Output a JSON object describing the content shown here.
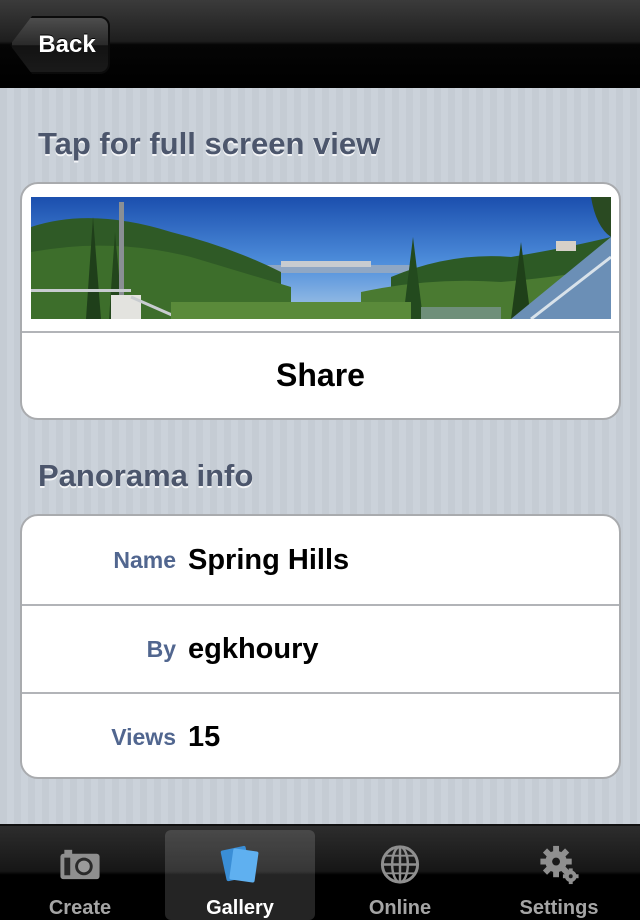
{
  "navbar": {
    "back_label": "Back"
  },
  "sections": {
    "image_header": "Tap for full screen view",
    "info_header": "Panorama info"
  },
  "image_group": {
    "share_label": "Share"
  },
  "info": {
    "rows": [
      {
        "label": "Name",
        "value": "Spring Hills"
      },
      {
        "label": "By",
        "value": "egkhoury"
      },
      {
        "label": "Views",
        "value": "15"
      }
    ]
  },
  "tabbar": {
    "tabs": [
      {
        "label": "Create",
        "icon": "camera-icon"
      },
      {
        "label": "Gallery",
        "icon": "gallery-icon",
        "selected": true
      },
      {
        "label": "Online",
        "icon": "globe-icon"
      },
      {
        "label": "Settings",
        "icon": "gear-icon"
      }
    ]
  },
  "colors": {
    "header_text": "#4c566c",
    "label_text": "#51668f",
    "background": "#c5ccd4"
  }
}
